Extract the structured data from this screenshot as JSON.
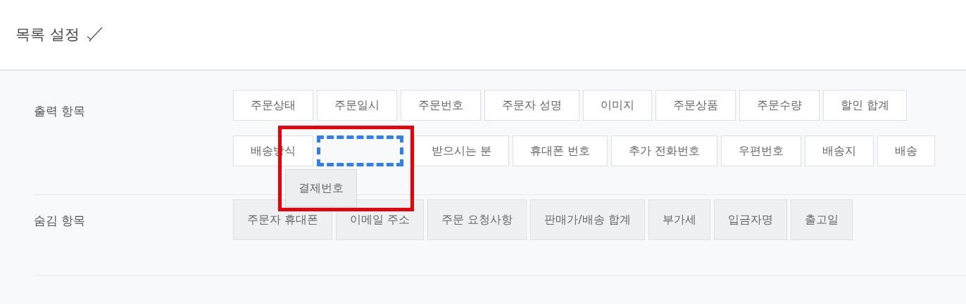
{
  "title": "목록 설정",
  "output_section": {
    "label": "출력 항목",
    "rows": [
      {
        "items": [
          {
            "kind": "chip",
            "label": "주문상태"
          },
          {
            "kind": "chip",
            "label": "주문일시"
          },
          {
            "kind": "chip",
            "label": "주문번호"
          },
          {
            "kind": "chip",
            "label": "주문자 성명"
          },
          {
            "kind": "chip",
            "label": "이미지"
          },
          {
            "kind": "chip",
            "label": "주문상품"
          },
          {
            "kind": "chip",
            "label": "주문수량"
          },
          {
            "kind": "chip",
            "label": "할인 합계"
          }
        ]
      },
      {
        "items": [
          {
            "kind": "chip",
            "label": "배송방식"
          },
          {
            "kind": "drop-slot"
          },
          {
            "kind": "chip",
            "label": "받으시는 분"
          },
          {
            "kind": "chip",
            "label": "휴대폰 번호"
          },
          {
            "kind": "chip",
            "label": "추가 전화번호"
          },
          {
            "kind": "chip",
            "label": "우편번호"
          },
          {
            "kind": "chip",
            "label": "배송지"
          },
          {
            "kind": "chip",
            "label": "배송"
          }
        ]
      }
    ],
    "dragging_item": {
      "label": "결제번호"
    }
  },
  "hidden_section": {
    "label": "숨김 항목",
    "items": [
      {
        "label": "주문자 휴대폰"
      },
      {
        "label": "이메일 주소"
      },
      {
        "label": "주문 요청사항"
      },
      {
        "label": "판매가/배송 합계"
      },
      {
        "label": "부가세"
      },
      {
        "label": "입금자명"
      },
      {
        "label": "출고일"
      }
    ]
  }
}
